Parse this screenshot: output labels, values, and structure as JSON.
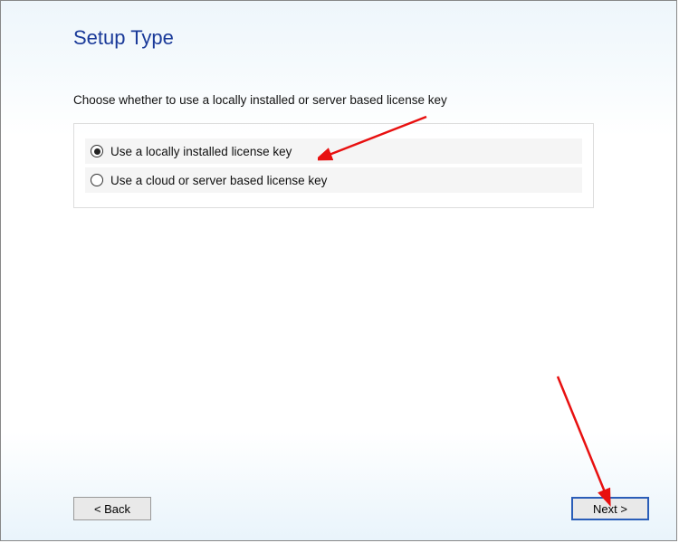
{
  "title": "Setup Type",
  "prompt": "Choose whether to use a locally installed or server based license key",
  "options": [
    {
      "label": "Use a locally installed license key",
      "checked": true
    },
    {
      "label": "Use a cloud or server based license key",
      "checked": false
    }
  ],
  "buttons": {
    "back": "< Back",
    "next": "Next >"
  }
}
